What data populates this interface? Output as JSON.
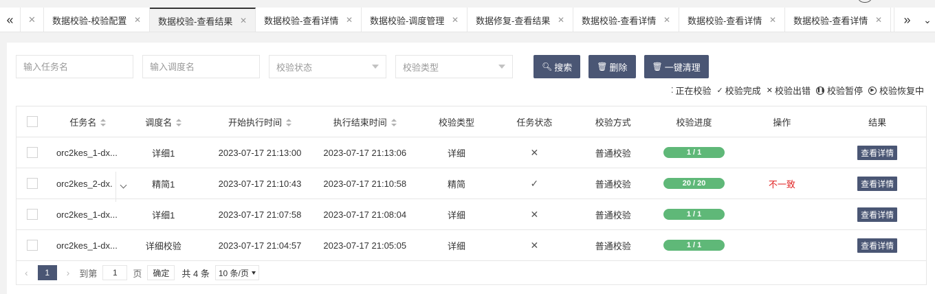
{
  "tabbar": {
    "tabs": [
      {
        "label": "数据校验-校验配置",
        "active": false
      },
      {
        "label": "数据校验-查看结果",
        "active": true
      },
      {
        "label": "数据校验-查看详情",
        "active": false
      },
      {
        "label": "数据校验-调度管理",
        "active": false
      },
      {
        "label": "数据修复-查看结果",
        "active": false
      },
      {
        "label": "数据校验-查看详情",
        "active": false
      },
      {
        "label": "数据校验-查看详情",
        "active": false
      },
      {
        "label": "数据校验-查看详情",
        "active": false
      }
    ]
  },
  "filters": {
    "task_placeholder": "输入任务名",
    "schedule_placeholder": "输入调度名",
    "status_select": "校验状态",
    "type_select": "校验类型",
    "search_label": "搜索",
    "delete_label": "删除",
    "clear_label": "一键清理"
  },
  "legend": {
    "running": "正在校验",
    "done": "校验完成",
    "error": "校验出错",
    "paused": "校验暂停",
    "resuming": "校验恢复中"
  },
  "table": {
    "headers": {
      "task": "任务名",
      "schedule": "调度名",
      "start": "开始执行时间",
      "end": "执行结束时间",
      "type": "校验类型",
      "status": "任务状态",
      "method": "校验方式",
      "progress": "校验进度",
      "op": "操作",
      "result": "结果"
    },
    "rows": [
      {
        "task": "orc2kes_1-dx...",
        "schedule": "详细1",
        "start": "2023-07-17 21:13:00",
        "end": "2023-07-17 21:13:06",
        "type": "详细",
        "status_icon": "✕",
        "method": "普通校验",
        "progress": "1 / 1",
        "op": "",
        "result": "查看详情"
      },
      {
        "task": "orc2kes_2-dx.",
        "schedule": "精简1",
        "start": "2023-07-17 21:10:43",
        "end": "2023-07-17 21:10:58",
        "type": "精简",
        "status_icon": "✓",
        "method": "普通校验",
        "progress": "20 / 20",
        "op": "不一致",
        "result": "查看详情"
      },
      {
        "task": "orc2kes_1-dx...",
        "schedule": "详细1",
        "start": "2023-07-17 21:07:58",
        "end": "2023-07-17 21:08:04",
        "type": "详细",
        "status_icon": "✕",
        "method": "普通校验",
        "progress": "1 / 1",
        "op": "",
        "result": "查看详情"
      },
      {
        "task": "orc2kes_1-dx...",
        "schedule": "详细校验",
        "start": "2023-07-17 21:04:57",
        "end": "2023-07-17 21:05:05",
        "type": "详细",
        "status_icon": "✕",
        "method": "普通校验",
        "progress": "1 / 1",
        "op": "",
        "result": "查看详情"
      }
    ]
  },
  "pager": {
    "current": "1",
    "goto_label": "到第",
    "goto_value": "1",
    "page_label": "页",
    "confirm_label": "确定",
    "total_label": "共 4 条",
    "page_size": "10 条/页"
  },
  "colors": {
    "primary": "#4a5674",
    "progress": "#5fb878",
    "danger": "#e02020"
  }
}
